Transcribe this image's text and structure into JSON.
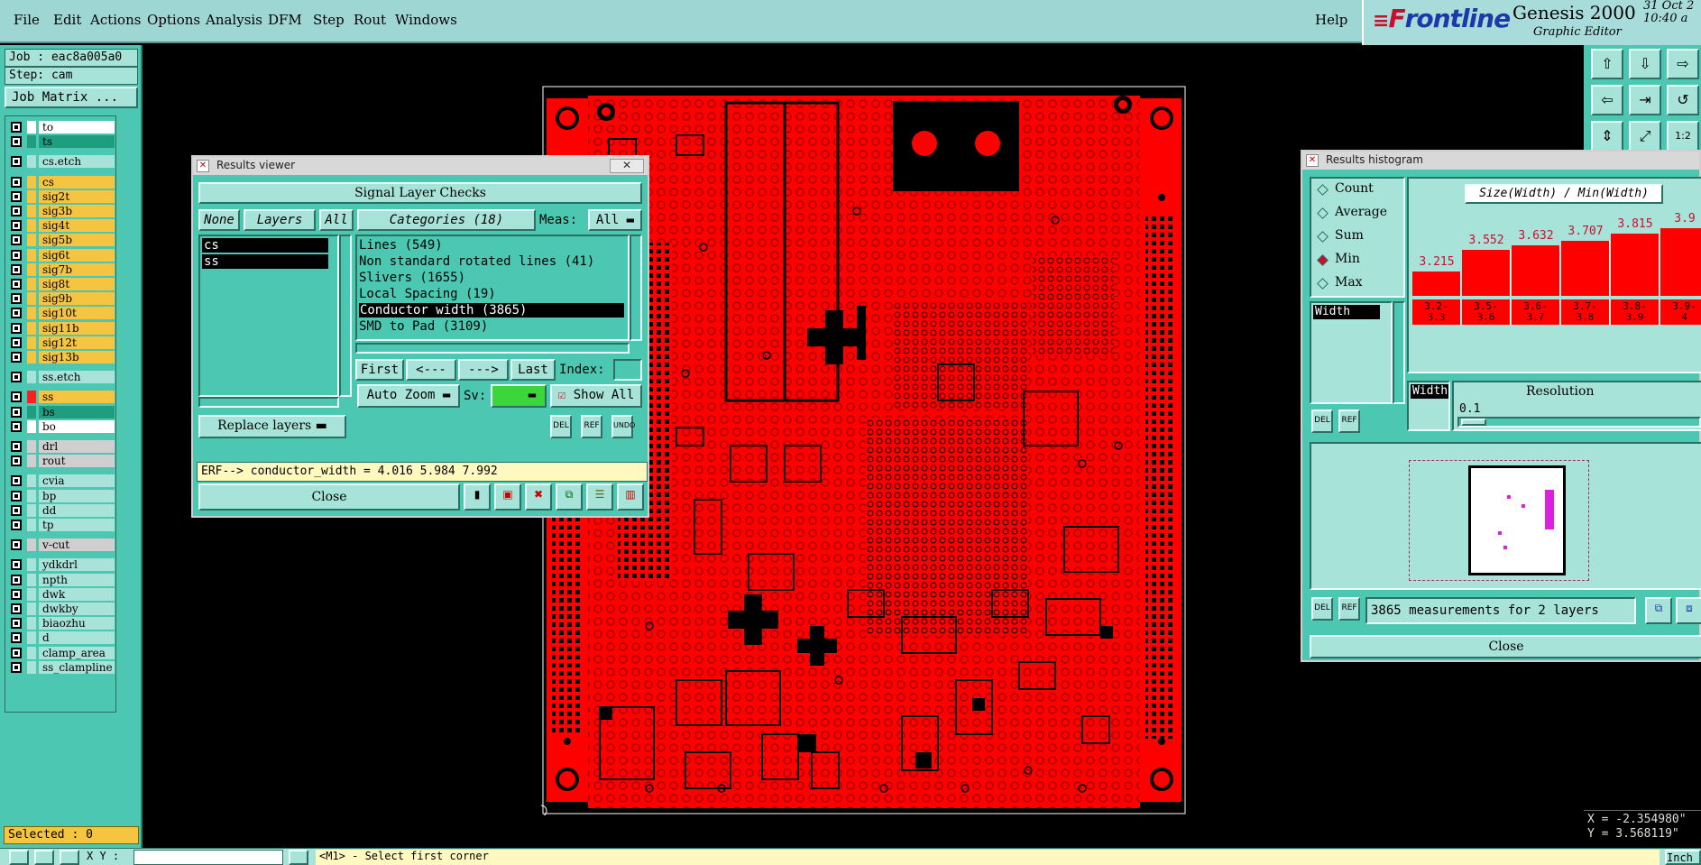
{
  "menu": {
    "items": [
      "File",
      "Edit",
      "Actions",
      "Options",
      "Analysis",
      "DFM",
      "Step",
      "Rout",
      "Windows"
    ],
    "help": "Help"
  },
  "brand": {
    "logo_first": "F",
    "logo_rest": "rontline",
    "product": "Genesis 2000",
    "subtitle": "Graphic Editor",
    "date": "31 Oct 2",
    "time": "10:40 a"
  },
  "left_panel": {
    "job": "Job : eac8a005a0",
    "step": "Step: cam",
    "job_matrix": "Job Matrix ...",
    "selected": "Selected : 0",
    "layers": [
      {
        "name": "to",
        "color": "#ffffff",
        "mark": "#ffffff"
      },
      {
        "name": "ts",
        "color": "#1e9e7e",
        "mark": "#1e9e7e"
      },
      {
        "name": "cs.etch",
        "color": "#a7e3d8",
        "mark": "#a7e3d8"
      },
      {
        "name": "cs",
        "color": "#f5c542",
        "mark": "#f5c542"
      },
      {
        "name": "sig2t",
        "color": "#f5c542",
        "mark": "#f5c542"
      },
      {
        "name": "sig3b",
        "color": "#f5c542",
        "mark": "#f5c542"
      },
      {
        "name": "sig4t",
        "color": "#f5c542",
        "mark": "#f5c542"
      },
      {
        "name": "sig5b",
        "color": "#f5c542",
        "mark": "#f5c542"
      },
      {
        "name": "sig6t",
        "color": "#f5c542",
        "mark": "#f5c542"
      },
      {
        "name": "sig7b",
        "color": "#f5c542",
        "mark": "#f5c542"
      },
      {
        "name": "sig8t",
        "color": "#f5c542",
        "mark": "#f5c542"
      },
      {
        "name": "sig9b",
        "color": "#f5c542",
        "mark": "#f5c542"
      },
      {
        "name": "sig10t",
        "color": "#f5c542",
        "mark": "#f5c542"
      },
      {
        "name": "sig11b",
        "color": "#f5c542",
        "mark": "#f5c542"
      },
      {
        "name": "sig12t",
        "color": "#f5c542",
        "mark": "#f5c542"
      },
      {
        "name": "sig13b",
        "color": "#f5c542",
        "mark": "#f5c542"
      },
      {
        "name": "ss.etch",
        "color": "#a7e3d8",
        "mark": "#a7e3d8"
      },
      {
        "name": "ss",
        "color": "#f5c542",
        "mark": "#ff2020"
      },
      {
        "name": "bs",
        "color": "#1e9e7e",
        "mark": "#1e9e7e"
      },
      {
        "name": "bo",
        "color": "#ffffff",
        "mark": "#ffffff"
      },
      {
        "name": "drl",
        "color": "#cfcfcf",
        "mark": "#cfcfcf"
      },
      {
        "name": "rout",
        "color": "#cfcfcf",
        "mark": "#cfcfcf"
      },
      {
        "name": "cvia",
        "color": "#a7e3d8",
        "mark": "#a7e3d8"
      },
      {
        "name": "bp",
        "color": "#a7e3d8",
        "mark": "#a7e3d8"
      },
      {
        "name": "dd",
        "color": "#a7e3d8",
        "mark": "#a7e3d8"
      },
      {
        "name": "tp",
        "color": "#a7e3d8",
        "mark": "#a7e3d8"
      },
      {
        "name": "v-cut",
        "color": "#cfcfcf",
        "mark": "#cfcfcf"
      },
      {
        "name": "ydkdrl",
        "color": "#a7e3d8",
        "mark": "#a7e3d8"
      },
      {
        "name": "npth",
        "color": "#a7e3d8",
        "mark": "#a7e3d8"
      },
      {
        "name": "dwk",
        "color": "#a7e3d8",
        "mark": "#a7e3d8"
      },
      {
        "name": "dwkby",
        "color": "#a7e3d8",
        "mark": "#a7e3d8"
      },
      {
        "name": "biaozhu",
        "color": "#a7e3d8",
        "mark": "#a7e3d8"
      },
      {
        "name": "d",
        "color": "#a7e3d8",
        "mark": "#a7e3d8"
      },
      {
        "name": "clamp_area",
        "color": "#a7e3d8",
        "mark": "#a7e3d8"
      },
      {
        "name": "ss_clampline",
        "color": "#a7e3d8",
        "mark": "#a7e3d8"
      }
    ]
  },
  "results_viewer": {
    "title": "Results viewer",
    "header": "Signal Layer Checks",
    "btn_none": "None",
    "btn_layers": "Layers",
    "btn_all": "All",
    "layer_items": [
      "cs",
      "ss"
    ],
    "replace_layers": "Replace layers",
    "categories_btn": "Categories (18)",
    "meas_label": "Meas:",
    "meas_value": "All",
    "categories": [
      "Lines (549)",
      "Non standard rotated lines (41)",
      "Slivers (1655)",
      "Local Spacing (19)",
      "Conductor width (3865)",
      "SMD to Pad (3109)"
    ],
    "selected_category": "Conductor width (3865)",
    "nav": {
      "first": "First",
      "prev": "<---",
      "next": "--->",
      "last": "Last",
      "index": "Index:"
    },
    "zoom": "Auto Zoom",
    "sv_label": "Sv:",
    "show_all": "Show All",
    "del": "DEL",
    "ref": "REF",
    "undo": "UNDO",
    "erf": "ERF--> conductor_width = 4.016 5.984 7.992",
    "close": "Close"
  },
  "histogram": {
    "title": "Results histogram",
    "options": [
      "Count",
      "Average",
      "Sum",
      "Min",
      "Max"
    ],
    "selected_option": "Min",
    "chart_title": "Size(Width) / Min(Width)",
    "list_item": "Width",
    "bars": [
      {
        "value": "3.215",
        "range_top": "3.2-",
        "range_bottom": "3.3"
      },
      {
        "value": "3.552",
        "range_top": "3.5-",
        "range_bottom": "3.6"
      },
      {
        "value": "3.632",
        "range_top": "3.6-",
        "range_bottom": "3.7"
      },
      {
        "value": "3.707",
        "range_top": "3.7-",
        "range_bottom": "3.8"
      },
      {
        "value": "3.815",
        "range_top": "3.8-",
        "range_bottom": "3.9"
      },
      {
        "value": "3.9",
        "range_top": "3.9-",
        "range_bottom": "4"
      }
    ],
    "width_label": "Width",
    "resolution_label": "Resolution",
    "resolution_value": "0.1",
    "del": "DEL",
    "ref": "REF",
    "measurements": "3865 measurements for 2 layers",
    "close": "Close"
  },
  "coords": {
    "x": "X = -2.354980\"",
    "y": "Y = 3.568119\""
  },
  "status": {
    "xy_label": "X Y :",
    "prompt": "<M1> - Select first corner",
    "right": "Inch"
  },
  "colors": {
    "copper": "#ff0000",
    "panel": "#4cc8b2",
    "button": "#a7e3d8"
  }
}
